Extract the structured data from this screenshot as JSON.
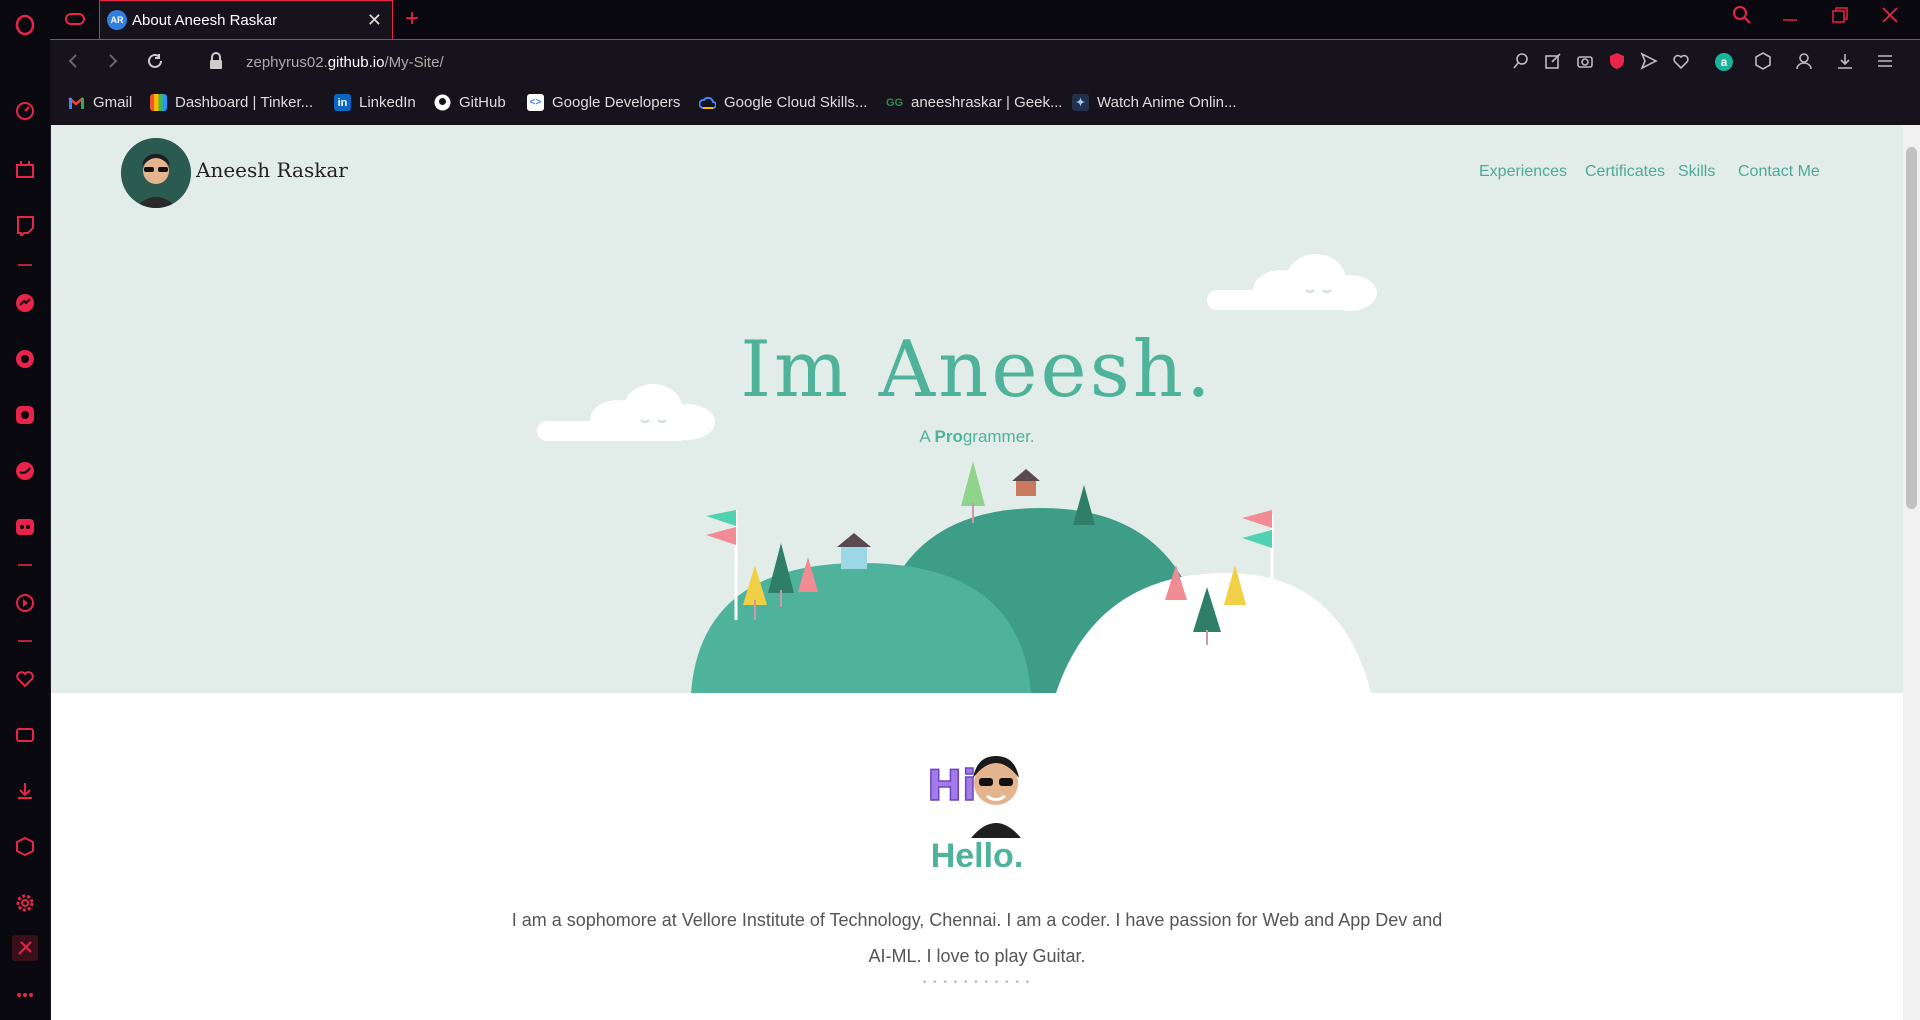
{
  "browser": {
    "tab_title": "About Aneesh Raskar",
    "tab_favicon_text": "AR",
    "url_prefix": "zephyrus02.",
    "url_domain": "github.io",
    "url_path": "/My-Site/",
    "accent_color": "#e8244a"
  },
  "bookmarks": [
    {
      "label": "Gmail",
      "icon": "gmail-icon"
    },
    {
      "label": "Dashboard | Tinker...",
      "icon": "tinkercad-icon"
    },
    {
      "label": "LinkedIn",
      "icon": "linkedin-icon"
    },
    {
      "label": "GitHub",
      "icon": "github-icon"
    },
    {
      "label": "Google Developers",
      "icon": "google-developers-icon"
    },
    {
      "label": "Google Cloud Skills...",
      "icon": "google-cloud-icon"
    },
    {
      "label": "aneeshraskar | Geek...",
      "icon": "geeksforgeeks-icon"
    },
    {
      "label": "Watch Anime Onlin...",
      "icon": "anime-icon"
    }
  ],
  "site": {
    "brand": "Aneesh Raskar",
    "nav": [
      "Experiences",
      "Certificates",
      "Skills",
      "Contact Me"
    ],
    "hero_title": "Im Aneesh.",
    "hero_sub_a": "A ",
    "hero_sub_bold": "Pro",
    "hero_sub_rest": "grammer.",
    "hi_text": "Hi",
    "hello": "Hello.",
    "bio": "I am a sophomore at Vellore Institute of Technology, Chennai. I am a coder. I have passion for Web and App Dev and AI-ML. I love to play Guitar.",
    "dots": "• • • • • • • • • • •",
    "theme_color": "#4fb39c",
    "hero_bg": "#e2ede9"
  }
}
